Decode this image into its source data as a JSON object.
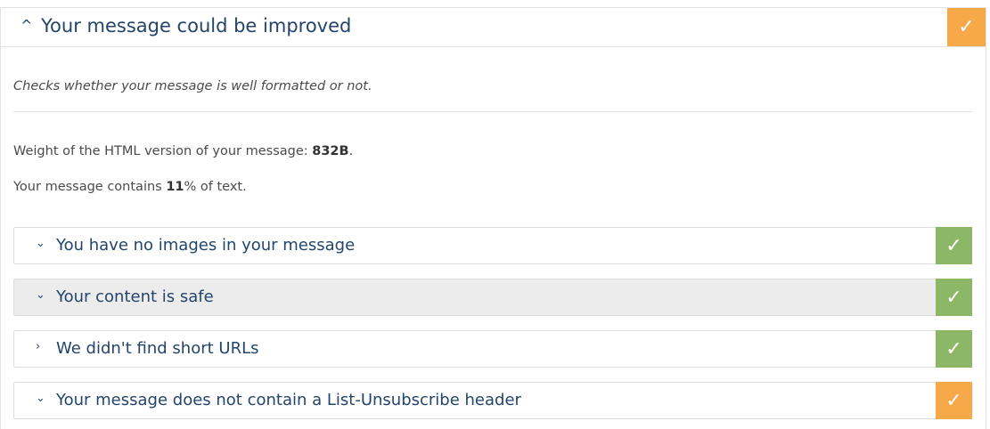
{
  "colors": {
    "warning": "#f7a94a",
    "success": "#8cb766",
    "title": "#23456b"
  },
  "header": {
    "chevron_icon": "chevron-up-icon",
    "title": "Your message could be improved",
    "status_icon": "checkmark-icon",
    "status_glyph": "✓",
    "status": "warning"
  },
  "description": "Checks whether your message is well formatted or not.",
  "weight_line": {
    "prefix": "Weight of the HTML version of your message: ",
    "value": "832B",
    "suffix": "."
  },
  "text_line": {
    "prefix": "Your message contains ",
    "value": "11",
    "suffix": "% of text."
  },
  "checks": [
    {
      "label": "You have no images in your message",
      "chevron": "⌄",
      "chevron_icon": "chevron-down-icon",
      "status": "success",
      "glyph": "✓"
    },
    {
      "label": "Your content is safe",
      "chevron": "⌄",
      "chevron_icon": "chevron-down-icon",
      "status": "success",
      "glyph": "✓",
      "highlighted": true
    },
    {
      "label": "We didn't find short URLs",
      "chevron": "›",
      "chevron_icon": "chevron-right-icon",
      "status": "success",
      "glyph": "✓"
    },
    {
      "label": "Your message does not contain a List-Unsubscribe header",
      "chevron": "⌄",
      "chevron_icon": "chevron-down-icon",
      "status": "warning",
      "glyph": "✓"
    }
  ]
}
